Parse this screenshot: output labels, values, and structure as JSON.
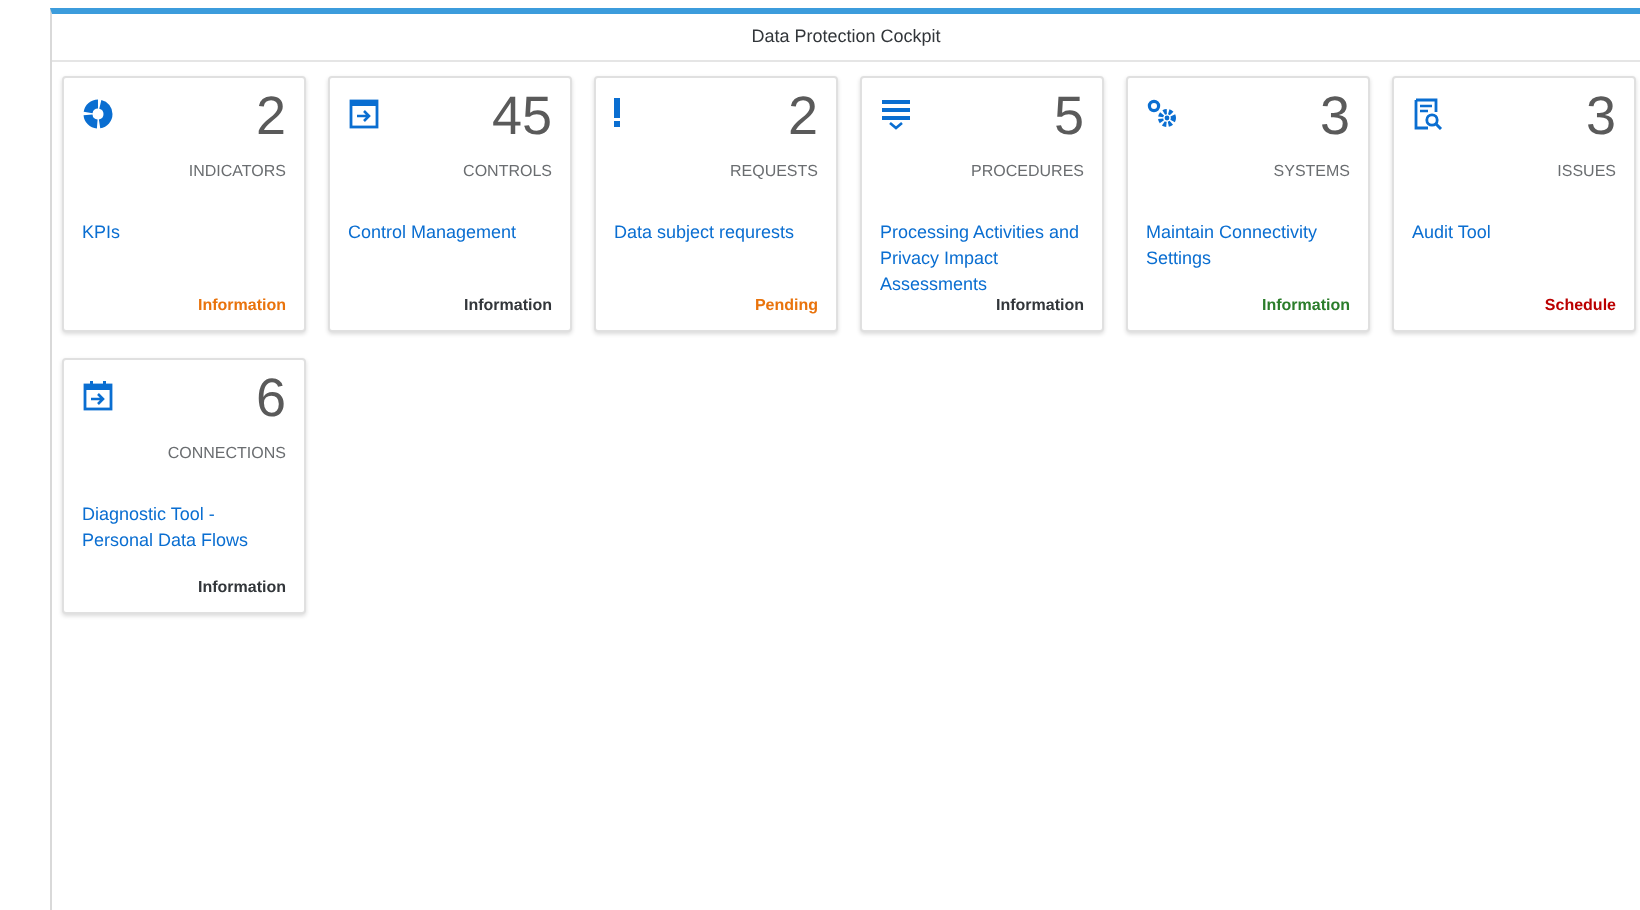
{
  "window": {
    "title": "Data Protection Cockpit"
  },
  "tiles": [
    {
      "count": "2",
      "unit": "INDICATORS",
      "title": "KPIs",
      "status": "Information",
      "color": "#e9730c"
    },
    {
      "count": "45",
      "unit": "CONTROLS",
      "title": "Control Management",
      "status": "Information",
      "color": "#32363a"
    },
    {
      "count": "2",
      "unit": "REQUESTS",
      "title": "Data subject requrests",
      "status": "Pending",
      "color": "#e9730c"
    },
    {
      "count": "5",
      "unit": "PROCEDURES",
      "title": "Processing Activities and Privacy Impact Assessments",
      "status": "Information",
      "color": "#32363a"
    },
    {
      "count": "3",
      "unit": "SYSTEMS",
      "title": "Maintain Connectivity Settings",
      "status": "Information",
      "color": "#2b7d2b"
    },
    {
      "count": "3",
      "unit": "ISSUES",
      "title": "Audit Tool",
      "status": "Schedule",
      "color": "#bb0000"
    },
    {
      "count": "6",
      "unit": "CONNECTIONS",
      "title": "Diagnostic Tool - Personal Data Flows",
      "status": "Information",
      "color": "#32363a"
    }
  ]
}
